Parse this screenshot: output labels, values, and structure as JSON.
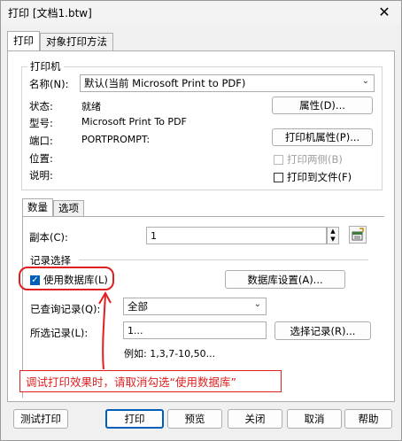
{
  "window": {
    "title": "打印 [文档1.btw]",
    "close_label": "✕"
  },
  "tabs": [
    {
      "label": "打印"
    },
    {
      "label": "对象打印方法"
    }
  ],
  "printer": {
    "group_label": "打印机",
    "name_label": "名称(N):",
    "name_value": "默认(当前 Microsoft Print to PDF)",
    "status_label": "状态:",
    "status_value": "就绪",
    "model_label": "型号:",
    "model_value": "Microsoft Print To PDF",
    "port_label": "端口:",
    "port_value": "PORTPROMPT:",
    "location_label": "位置:",
    "comment_label": "说明:",
    "properties_button": "属性(D)...",
    "printer_properties_button": "打印机属性(P)...",
    "print_both_sides": "打印两侧(B)",
    "print_to_file": "打印到文件(F)"
  },
  "inner_tabs": [
    {
      "label": "数量"
    },
    {
      "label": "选项"
    }
  ],
  "quantity": {
    "copies_label": "副本(C):",
    "copies_value": "1"
  },
  "records": {
    "group_label": "记录选择",
    "use_database": "使用数据库(L)",
    "database_settings_button": "数据库设置(A)...",
    "queried_label": "已查询记录(Q):",
    "queried_value": "全部",
    "selected_label": "所选记录(L):",
    "selected_value": "1...",
    "select_records_button": "选择记录(R)...",
    "example": "例如:  1,3,7-10,50..."
  },
  "annotation": {
    "text": "调试打印效果时，请取消勾选“使用数据库”",
    "color": "#e02020"
  },
  "buttons": {
    "test_print": "测试打印",
    "print": "打印",
    "preview": "预览",
    "close": "关闭",
    "cancel": "取消",
    "help": "帮助"
  }
}
